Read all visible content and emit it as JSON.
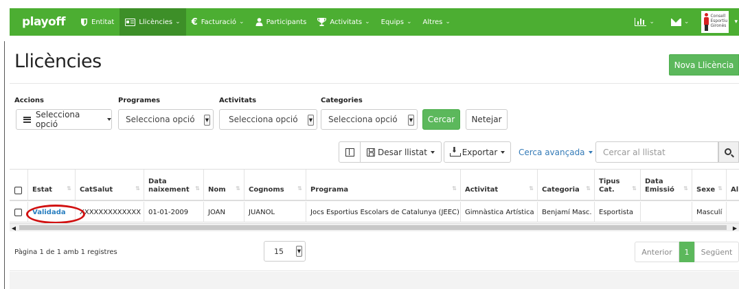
{
  "navbar": {
    "brand": "playoff",
    "items": [
      {
        "label": "Entitat",
        "icon": "shield-icon",
        "active": false,
        "dropdown": false
      },
      {
        "label": "Llicències",
        "icon": "id-card-icon",
        "active": true,
        "dropdown": true
      },
      {
        "label": "Facturació",
        "icon": "euro-icon",
        "active": false,
        "dropdown": true
      },
      {
        "label": "Participants",
        "icon": "user-icon",
        "active": false,
        "dropdown": false
      },
      {
        "label": "Activitats",
        "icon": "trophy-icon",
        "active": false,
        "dropdown": true
      },
      {
        "label": "Equips",
        "icon": "",
        "active": false,
        "dropdown": true
      },
      {
        "label": "Altres",
        "icon": "",
        "active": false,
        "dropdown": true
      }
    ],
    "right": {
      "stats_icon": "bar-chart-icon",
      "mail_icon": "envelope-icon",
      "logo_text": [
        "Consell",
        "Esportiu",
        "Gironès"
      ]
    },
    "color": "#4cae32"
  },
  "header": {
    "title": "Llicències",
    "new_button": "Nova Llicència"
  },
  "filters": {
    "accions": {
      "label": "Accions",
      "value": "Selecciona opció"
    },
    "programes": {
      "label": "Programes",
      "value": "Selecciona opció"
    },
    "activitats": {
      "label": "Activitats",
      "value": "Selecciona opció"
    },
    "categories": {
      "label": "Categories",
      "value": "Selecciona opció"
    },
    "search_button": "Cercar",
    "clear_button": "Netejar"
  },
  "toolbar": {
    "save_list": "Desar llistat",
    "export": "Exportar",
    "advanced_search": "Cerca avançada",
    "search_placeholder": "Cercar al llistat"
  },
  "table": {
    "columns": [
      {
        "label": ""
      },
      {
        "label": "Estat"
      },
      {
        "label": "CatSalut"
      },
      {
        "label": "Data naixement"
      },
      {
        "label": "Nom"
      },
      {
        "label": "Cognoms"
      },
      {
        "label": "Programa"
      },
      {
        "label": "Activitat"
      },
      {
        "label": "Categoria"
      },
      {
        "label": "Tipus Cat."
      },
      {
        "label": "Data Emissió"
      },
      {
        "label": "Sexe"
      },
      {
        "label": "Al"
      }
    ],
    "rows": [
      {
        "estat": "Validada",
        "catsalut": "XXXXXXXXXXXXX",
        "data_naixement": "01-01-2009",
        "nom": "JOAN",
        "cognoms": "JUANOL",
        "programa": "Jocs Esportius Escolars de Catalunya (JEEC)",
        "activitat": "Gimnàstica Artística",
        "categoria": "Benjamí Masc.",
        "tipus_cat": "Esportista",
        "data_emissio": "",
        "sexe": "Masculí"
      }
    ]
  },
  "pagination": {
    "info": "Pàgina 1 de 1 amb 1 registres",
    "per_page": "15",
    "prev": "Anterior",
    "current": "1",
    "next": "Següent"
  }
}
